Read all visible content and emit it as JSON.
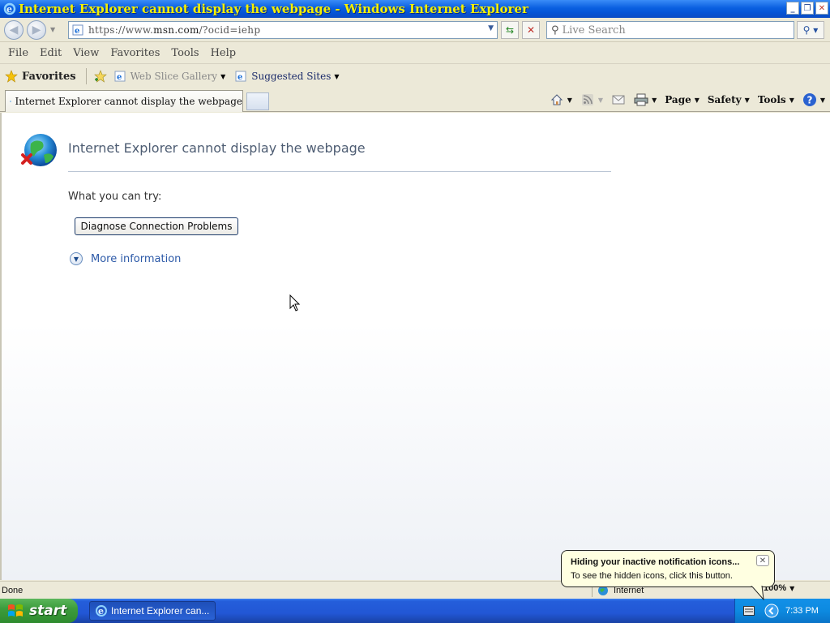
{
  "window": {
    "title": "Internet Explorer cannot display the webpage - Windows Internet Explorer",
    "minimize": "_",
    "restore": "❐",
    "close": "✕"
  },
  "address": {
    "url_prefix": "https://www.",
    "url_domain": "msn.com",
    "url_rest": "/?ocid=iehp",
    "search_placeholder": "Live Search"
  },
  "menu": [
    "File",
    "Edit",
    "View",
    "Favorites",
    "Tools",
    "Help"
  ],
  "favorites_bar": {
    "favorites_label": "Favorites",
    "web_slice": "Web Slice Gallery",
    "suggested": "Suggested Sites"
  },
  "tab": {
    "title": "Internet Explorer cannot display the webpage"
  },
  "command_bar": {
    "page": "Page",
    "safety": "Safety",
    "tools": "Tools"
  },
  "content": {
    "heading": "Internet Explorer cannot display the webpage",
    "try_label": "What you can try:",
    "diagnose_button": "Diagnose Connection Problems",
    "more_info": "More information"
  },
  "status": {
    "text": "Done",
    "zone": "Internet",
    "zoom": "100%"
  },
  "taskbar": {
    "start": "start",
    "task_label": "Internet Explorer can...",
    "clock": "7:33 PM"
  },
  "balloon": {
    "title": "Hiding your inactive notification icons...",
    "body": "To see the hidden icons, click this button."
  },
  "icons": {
    "ie": "ie-logo-icon",
    "back": "back-arrow-icon",
    "forward": "forward-arrow-icon",
    "refresh": "refresh-icon",
    "stop": "stop-icon",
    "search": "search-icon",
    "home": "home-icon",
    "rss": "rss-feed-icon",
    "mail": "mail-icon",
    "print": "print-icon",
    "help": "help-icon",
    "error_globe": "error-globe-icon",
    "windows": "windows-logo-icon"
  },
  "colors": {
    "title_text": "#f4f000",
    "title_bar": "#0a5fe0",
    "start_button": "#3d9c3d",
    "link": "#2d5aa8",
    "balloon_bg": "#ffffe1"
  }
}
